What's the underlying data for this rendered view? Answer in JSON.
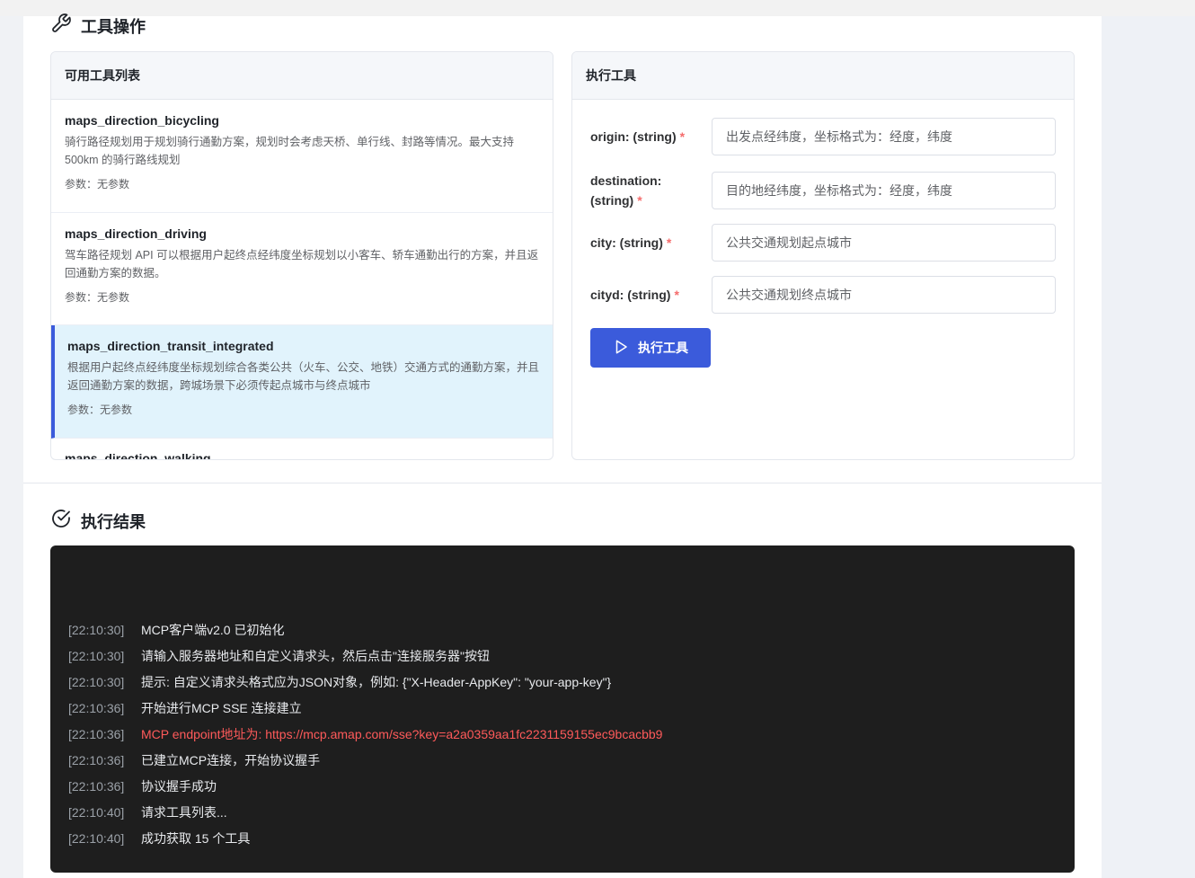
{
  "tools_section": {
    "title": "工具操作",
    "list_header": "可用工具列表",
    "tools": [
      {
        "name": "maps_direction_bicycling",
        "desc": "骑行路径规划用于规划骑行通勤方案，规划时会考虑天桥、单行线、封路等情况。最大支持 500km 的骑行路线规划",
        "params": "参数：无参数"
      },
      {
        "name": "maps_direction_driving",
        "desc": "驾车路径规划 API 可以根据用户起终点经纬度坐标规划以小客车、轿车通勤出行的方案，并且返回通勤方案的数据。",
        "params": "参数：无参数"
      },
      {
        "name": "maps_direction_transit_integrated",
        "desc": "根据用户起终点经纬度坐标规划综合各类公共（火车、公交、地铁）交通方式的通勤方案，并且返回通勤方案的数据，跨城场景下必须传起点城市与终点城市",
        "params": "参数：无参数"
      },
      {
        "name": "maps_direction_walking"
      }
    ]
  },
  "exec_panel": {
    "header": "执行工具",
    "fields": [
      {
        "label": "origin: (string)",
        "required": "*",
        "placeholder": "出发点经纬度，坐标格式为：经度，纬度"
      },
      {
        "label": "destination: (string)",
        "required": "*",
        "placeholder": "目的地经纬度，坐标格式为：经度，纬度"
      },
      {
        "label": "city: (string)",
        "required": "*",
        "placeholder": "公共交通规划起点城市"
      },
      {
        "label": "cityd: (string)",
        "required": "*",
        "placeholder": "公共交通规划终点城市"
      }
    ],
    "button_label": "执行工具"
  },
  "results_section": {
    "title": "执行结果",
    "logs": [
      {
        "time": "[22:10:30]",
        "msg": "MCP客户端v2.0 已初始化"
      },
      {
        "time": "[22:10:30]",
        "msg": "请输入服务器地址和自定义请求头，然后点击\"连接服务器\"按钮"
      },
      {
        "time": "[22:10:30]",
        "msg": "提示: 自定义请求头格式应为JSON对象，例如: {\"X-Header-AppKey\": \"your-app-key\"}"
      },
      {
        "time": "[22:10:36]",
        "msg": "开始进行MCP SSE 连接建立"
      },
      {
        "time": "[22:10:36]",
        "msg": "MCP endpoint地址为: https://mcp.amap.com/sse?key=a2a0359aa1fc2231159155ec9bcacbb9",
        "type": "error"
      },
      {
        "time": "[22:10:36]",
        "msg": "已建立MCP连接，开始协议握手"
      },
      {
        "time": "[22:10:36]",
        "msg": "协议握手成功"
      },
      {
        "time": "[22:10:40]",
        "msg": "请求工具列表..."
      },
      {
        "time": "[22:10:40]",
        "msg": "成功获取 15 个工具"
      }
    ]
  },
  "colors": {
    "accent": "#3b5bdb",
    "selected_bg": "#e1f3fc",
    "required": "#f56c6c",
    "console_bg": "#1e1e1e",
    "error_text": "#ff5a5a"
  }
}
